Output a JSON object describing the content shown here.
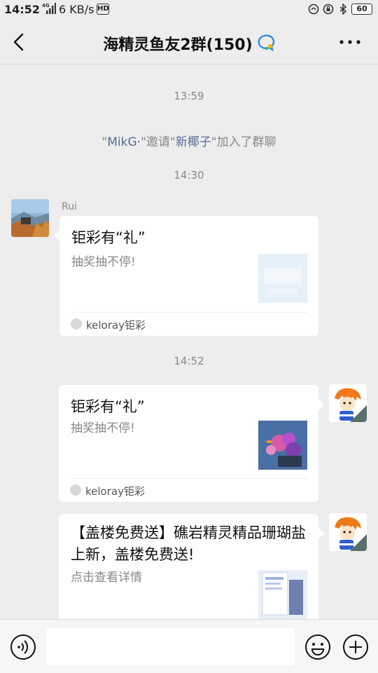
{
  "status_bar": {
    "time": "14:52",
    "network_label": "4G",
    "speed": "6 KB/s",
    "hd_label": "HD",
    "battery": "60"
  },
  "header": {
    "title": "海精灵鱼友2群(150)"
  },
  "chat": {
    "timestamp_1": "13:59",
    "system_message": {
      "before": "\"",
      "inviter": "MikG·",
      "middle": "\"邀请\"",
      "invitee": "新椰子",
      "after": "\"加入了群聊"
    },
    "timestamp_2": "14:30",
    "msg1": {
      "sender": "Rui",
      "title": "钜彩有“礼”",
      "desc": "抽奖抽不停!",
      "source": "keloray钜彩"
    },
    "timestamp_3": "14:52",
    "msg2": {
      "title": "钜彩有“礼”",
      "desc": "抽奖抽不停!",
      "source": "keloray钜彩"
    },
    "msg3": {
      "title": "【盖楼免费送】礁岩精灵精品珊瑚盐上新，盖楼免费送!",
      "desc": "点击查看详情"
    }
  },
  "colors": {
    "background": "#ededed",
    "link": "#576b95",
    "card": "#ffffff"
  }
}
